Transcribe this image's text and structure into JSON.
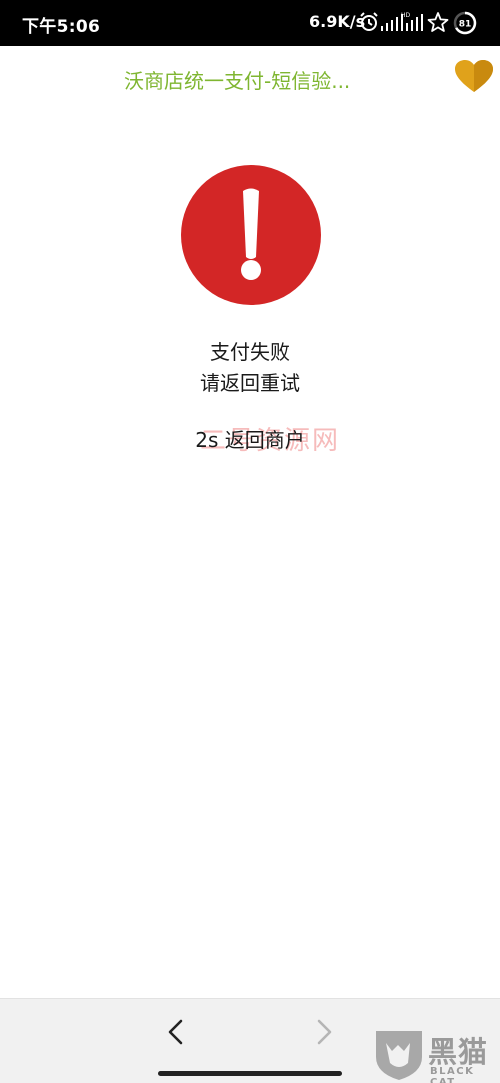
{
  "status_bar": {
    "time": "下午5:06",
    "network_speed": "6.9K/s",
    "network_type_label": "HD",
    "battery_level": "81",
    "icons": [
      "alarm-icon",
      "signal-icon",
      "signal-hd-icon",
      "star-icon",
      "battery-icon"
    ]
  },
  "header": {
    "title": "沃商店统一支付-短信验...",
    "title_color": "#7fb631",
    "menu_icon": "heart-icon",
    "menu_icon_color": "#e0a21b"
  },
  "main": {
    "alert_icon": "exclamation-circle-icon",
    "alert_color": "#d32626",
    "message_line1": "支付失败",
    "message_line2": "请返回重试",
    "countdown": "2s",
    "return_label": "返回商户",
    "watermark": "二号资源网"
  },
  "bottom_bar": {
    "back_icon": "chevron-left-icon",
    "forward_icon": "chevron-right-icon",
    "forward_enabled": false,
    "brand_logo": "黑猫",
    "brand_sub": "BLACK CAT"
  }
}
